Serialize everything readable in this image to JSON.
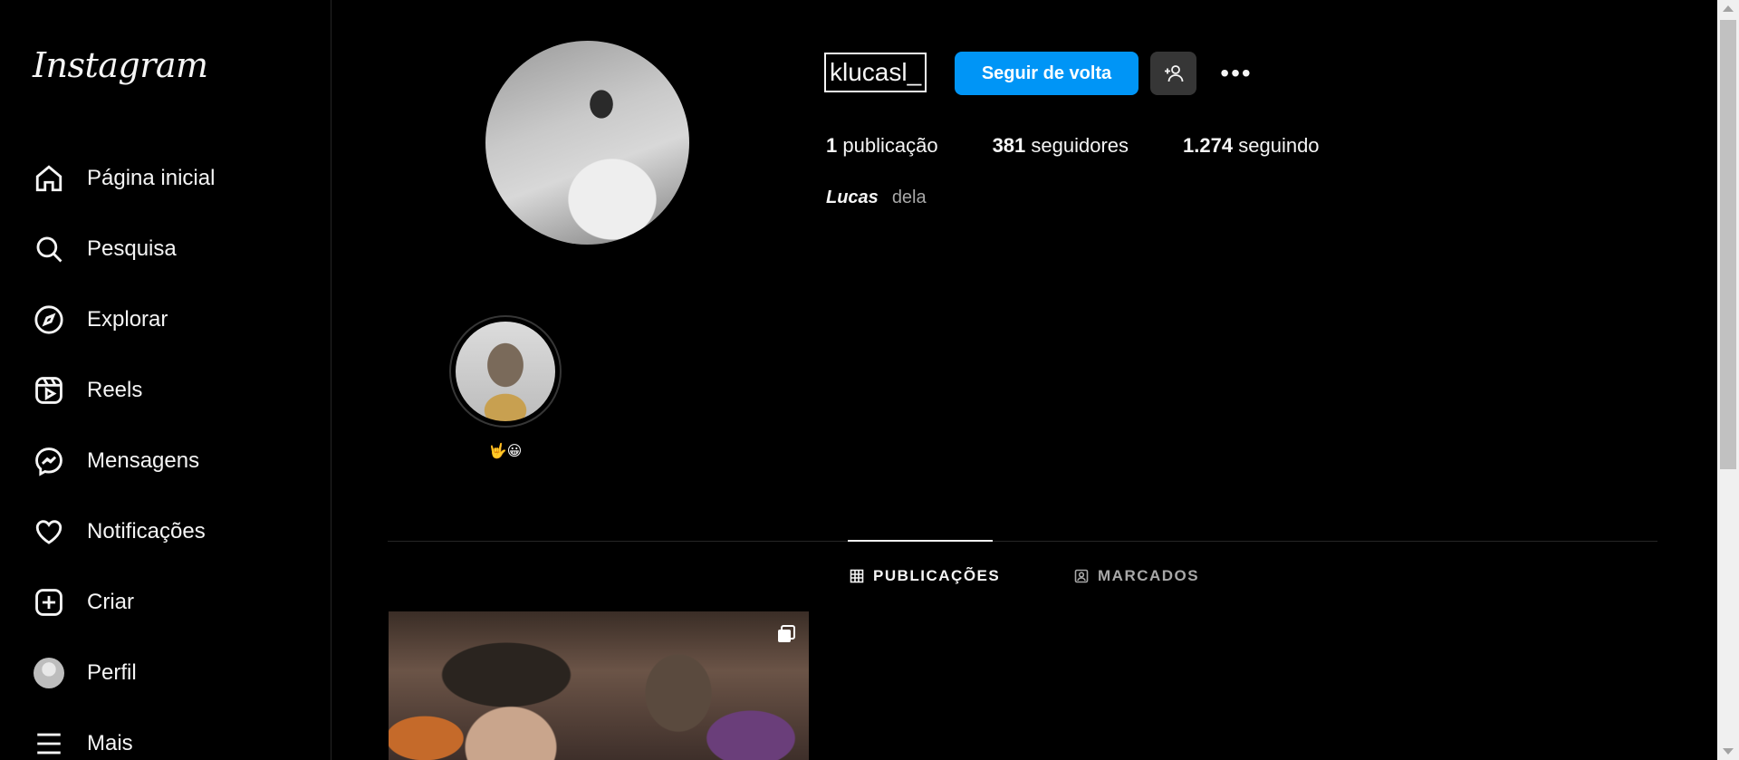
{
  "sidebar": {
    "logo": "Instagram",
    "items": [
      {
        "label": "Página inicial",
        "icon": "home-icon"
      },
      {
        "label": "Pesquisa",
        "icon": "search-icon"
      },
      {
        "label": "Explorar",
        "icon": "compass-icon"
      },
      {
        "label": "Reels",
        "icon": "reels-icon"
      },
      {
        "label": "Mensagens",
        "icon": "messenger-icon"
      },
      {
        "label": "Notificações",
        "icon": "heart-icon"
      },
      {
        "label": "Criar",
        "icon": "plus-square-icon"
      },
      {
        "label": "Perfil",
        "icon": "avatar"
      },
      {
        "label": "Mais",
        "icon": "menu-icon"
      }
    ]
  },
  "profile": {
    "username": "klucasl_",
    "follow_label": "Seguir de volta",
    "stats": {
      "posts_count": "1",
      "posts_label": "publicação",
      "followers_count": "381",
      "followers_label": "seguidores",
      "following_count": "1.274",
      "following_label": "seguindo"
    },
    "name": "Lucas",
    "pronouns": "dela"
  },
  "highlights": [
    {
      "label": "🤟😀"
    }
  ],
  "tabs": [
    {
      "label": "PUBLICAÇÕES",
      "active": true
    },
    {
      "label": "MARCADOS",
      "active": false
    }
  ],
  "colors": {
    "background": "#000000",
    "accent": "#0095f6",
    "text": "#f5f5f5",
    "muted": "#a8a8a8",
    "divider": "#262626"
  }
}
